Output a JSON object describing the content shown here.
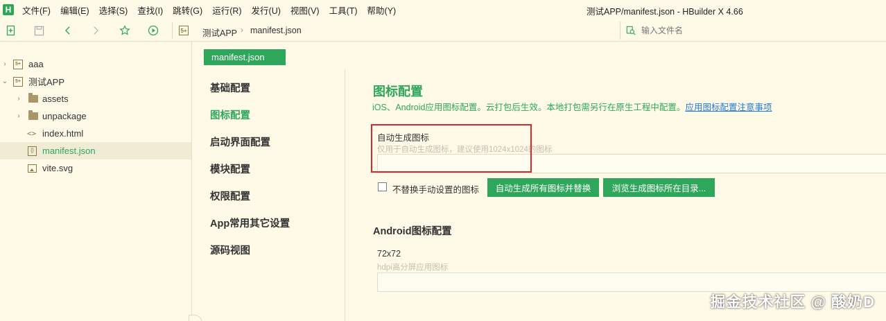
{
  "menubar": {
    "app_logo": "H",
    "items": [
      "文件(F)",
      "编辑(E)",
      "选择(S)",
      "查找(I)",
      "跳转(G)",
      "运行(R)",
      "发行(U)",
      "视图(V)",
      "工具(T)",
      "帮助(Y)"
    ],
    "window_title": "测试APP/manifest.json - HBuilder X 4.66"
  },
  "toolbar": {
    "icons": [
      "new-file-icon",
      "save-icon",
      "back-icon",
      "forward-icon",
      "star-icon",
      "run-icon"
    ],
    "breadcrumb": [
      "测试APP",
      "manifest.json"
    ],
    "file_icon_text": "5+",
    "search_placeholder": "输入文件名"
  },
  "sidebar": {
    "tree": [
      {
        "label": "aaa",
        "type": "project",
        "expanded": false
      },
      {
        "label": "测试APP",
        "type": "project",
        "expanded": true
      },
      {
        "label": "assets",
        "type": "folder",
        "expanded": false
      },
      {
        "label": "unpackage",
        "type": "folder",
        "expanded": false
      },
      {
        "label": "index.html",
        "type": "html"
      },
      {
        "label": "manifest.json",
        "type": "json",
        "selected": true
      },
      {
        "label": "vite.svg",
        "type": "image"
      }
    ]
  },
  "editor": {
    "tab_label": "manifest.json",
    "nav": [
      "基础配置",
      "图标配置",
      "启动界面配置",
      "模块配置",
      "权限配置",
      "App常用其它设置",
      "源码视图"
    ],
    "active_nav": "图标配置",
    "section": {
      "title": "图标配置",
      "description": "iOS、Android应用图标配置。云打包后生效。本地打包需另行在原生工程中配置。",
      "link": "应用图标配置注意事项"
    },
    "auto_icon": {
      "label": "自动生成图标",
      "hint": "仅用于自动生成图标，建议使用1024x1024的图标",
      "value": ""
    },
    "checkbox_label": "不替换手动设置的图标",
    "checkbox_checked": false,
    "buttons": {
      "generate": "自动生成所有图标并替换",
      "browse": "浏览生成图标所在目录..."
    },
    "android": {
      "title": "Android图标配置",
      "size_label": "72x72",
      "size_hint": "hdpi高分屏应用图标",
      "value": ""
    }
  },
  "watermark": "掘金技术社区 @ 酸奶D",
  "colors": {
    "accent": "#2fa75a",
    "background": "#fffae8",
    "link": "#1e7ad8",
    "highlight": "#d9272e"
  }
}
